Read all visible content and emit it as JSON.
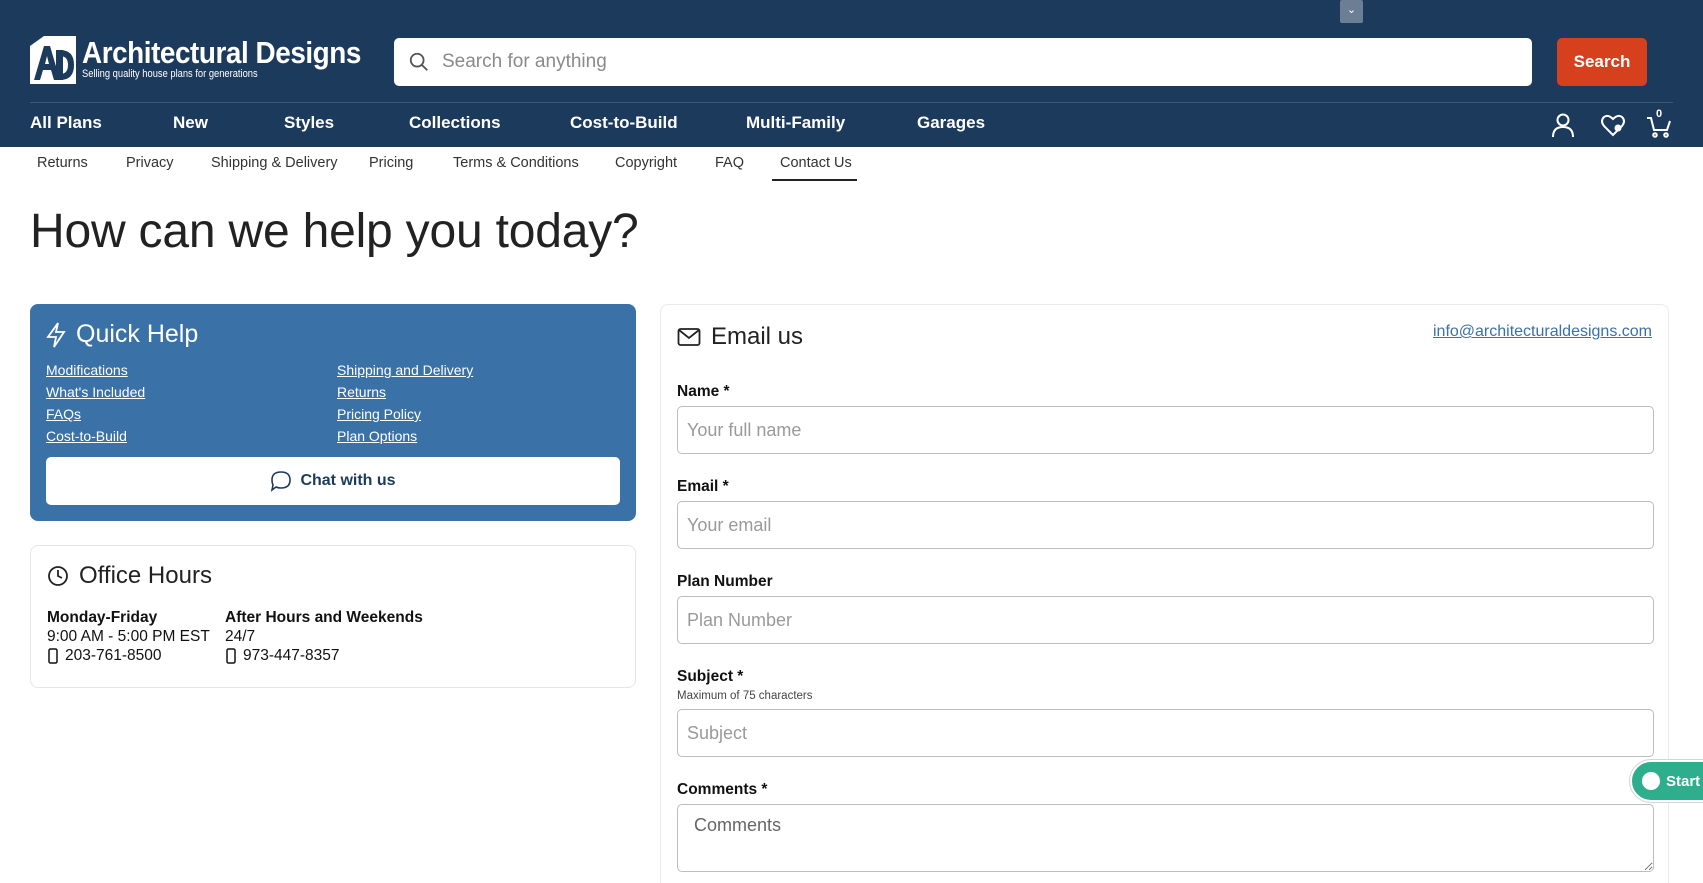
{
  "header": {
    "logo_name": "Architectural Designs",
    "logo_tagline": "Selling quality house plans for generations",
    "search_placeholder": "Search for anything",
    "search_button": "Search",
    "cart_count": "0"
  },
  "main_nav": [
    "All Plans",
    "New",
    "Styles",
    "Collections",
    "Cost-to-Build",
    "Multi-Family",
    "Garages"
  ],
  "sub_nav": {
    "items": [
      "Returns",
      "Privacy",
      "Shipping & Delivery",
      "Pricing",
      "Terms & Conditions",
      "Copyright",
      "FAQ",
      "Contact Us"
    ],
    "active": "Contact Us"
  },
  "page": {
    "title": "How can we help you today?"
  },
  "quick_help": {
    "title": "Quick Help",
    "links_left": [
      "Modifications",
      "What's Included",
      "FAQs",
      "Cost-to-Build"
    ],
    "links_right": [
      "Shipping and Delivery",
      "Returns",
      "Pricing Policy",
      "Plan Options"
    ],
    "chat_button": "Chat with us"
  },
  "office_hours": {
    "title": "Office Hours",
    "weekday": {
      "heading": "Monday-Friday",
      "hours": "9:00 AM - 5:00 PM EST",
      "phone": "203-761-8500"
    },
    "after_hours": {
      "heading": "After Hours and Weekends",
      "hours": "24/7",
      "phone": "973-447-8357"
    }
  },
  "email_form": {
    "title": "Email us",
    "email_address": "info@architecturaldesigns.com",
    "name_label": "Name *",
    "name_placeholder": "Your full name",
    "email_label": "Email *",
    "email_placeholder": "Your email",
    "plan_label": "Plan Number",
    "plan_placeholder": "Plan Number",
    "subject_label": "Subject *",
    "subject_hint": "Maximum of 75 characters",
    "subject_placeholder": "Subject",
    "comments_label": "Comments *",
    "comments_placeholder": "Comments"
  },
  "chat_widget": {
    "label": "Start Chat"
  },
  "colors": {
    "header_bg": "#1c3a5b",
    "search_button": "#d7401c",
    "quick_help_bg": "#3a71a6",
    "chat_widget": "#2fae8e",
    "link": "#3a71a6"
  }
}
